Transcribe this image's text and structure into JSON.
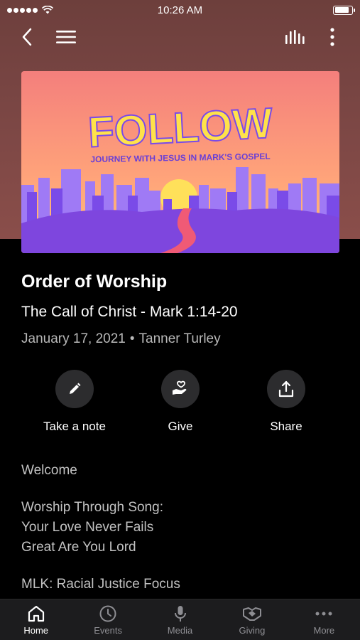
{
  "status_bar": {
    "time": "10:26 AM",
    "battery_level": 0.9
  },
  "icons": {
    "back": "chevron-left-icon",
    "menu": "hamburger-icon",
    "audio": "audio-bars-icon",
    "more": "vertical-dots-icon"
  },
  "artwork": {
    "headline": "FOLLOW",
    "tagline": "JOURNEY WITH JESUS IN MARK'S GOSPEL"
  },
  "sermon": {
    "title": "Order of Worship",
    "subtitle": "The Call of Christ - Mark 1:14-20",
    "date": "January 17, 2021",
    "separator": "•",
    "speaker": "Tanner Turley"
  },
  "actions": [
    {
      "label": "Take a note",
      "icon": "pencil-icon"
    },
    {
      "label": "Give",
      "icon": "heart-hand-icon"
    },
    {
      "label": "Share",
      "icon": "share-icon"
    }
  ],
  "content": {
    "welcome": "Welcome",
    "song_heading": "Worship Through Song:",
    "song1": "Your Love Never Fails",
    "song2": "Great Are You Lord",
    "mlk": "MLK: Racial Justice Focus"
  },
  "tabs": [
    {
      "label": "Home",
      "icon": "home-icon",
      "active": true
    },
    {
      "label": "Events",
      "icon": "clock-icon",
      "active": false
    },
    {
      "label": "Media",
      "icon": "microphone-icon",
      "active": false
    },
    {
      "label": "Giving",
      "icon": "handshake-icon",
      "active": false
    },
    {
      "label": "More",
      "icon": "horizontal-dots-icon",
      "active": false
    }
  ],
  "colors": {
    "hero_background": "#7a4644",
    "artwork_top": "#f3857a",
    "artwork_bottom": "#ffc07a",
    "headline": "#ffe24a",
    "city": "#8c5cf0",
    "path": "#f2607a",
    "action_circle": "#2c2c2e",
    "tab_bar": "#1c1c1e"
  }
}
